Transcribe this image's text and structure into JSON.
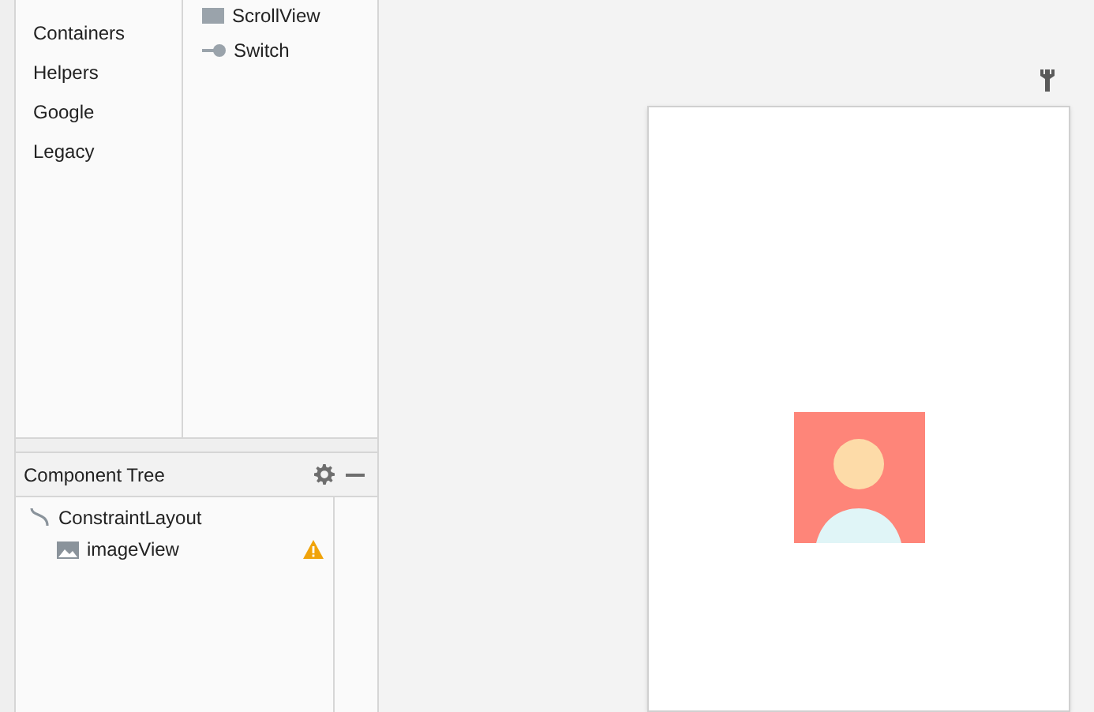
{
  "palette": {
    "categories": [
      "Containers",
      "Helpers",
      "Google",
      "Legacy"
    ],
    "widgets": [
      {
        "label": "ScrollView",
        "kind": "scrollview"
      },
      {
        "label": "Switch",
        "kind": "switch"
      }
    ]
  },
  "component_tree": {
    "title": "Component Tree",
    "nodes": [
      {
        "label": "ConstraintLayout",
        "kind": "layout",
        "warning": false,
        "children": [
          {
            "label": "imageView",
            "kind": "image",
            "warning": true
          }
        ]
      }
    ]
  }
}
